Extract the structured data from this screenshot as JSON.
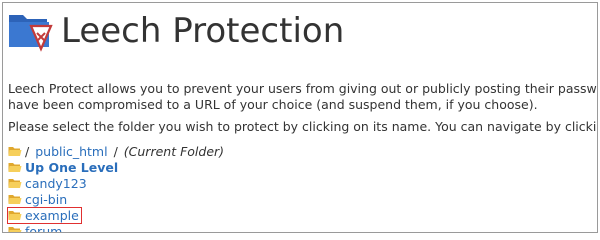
{
  "page": {
    "title": "Leech Protection",
    "icon": "leech-protection-folder-icon"
  },
  "description": {
    "line1": "Leech Protect allows you to prevent your users from giving out or publicly posting their passwords to a re",
    "line2": "have been compromised to a URL of your choice (and suspend them, if you choose)."
  },
  "instructions": "Please select the folder you wish to protect by clicking on its name. You can navigate by clicking on icons.",
  "breadcrumb": {
    "root_slash": "/",
    "folder": "public_html",
    "slash": "/",
    "current_label": "(Current Folder)"
  },
  "folders": {
    "up": "Up One Level",
    "items": [
      "candy123",
      "cgi-bin",
      "example",
      "forum"
    ],
    "highlighted": "example"
  },
  "colors": {
    "link": "#2a6ebb",
    "highlight_border": "#e03030",
    "folder_icon": "#f2c14e"
  }
}
